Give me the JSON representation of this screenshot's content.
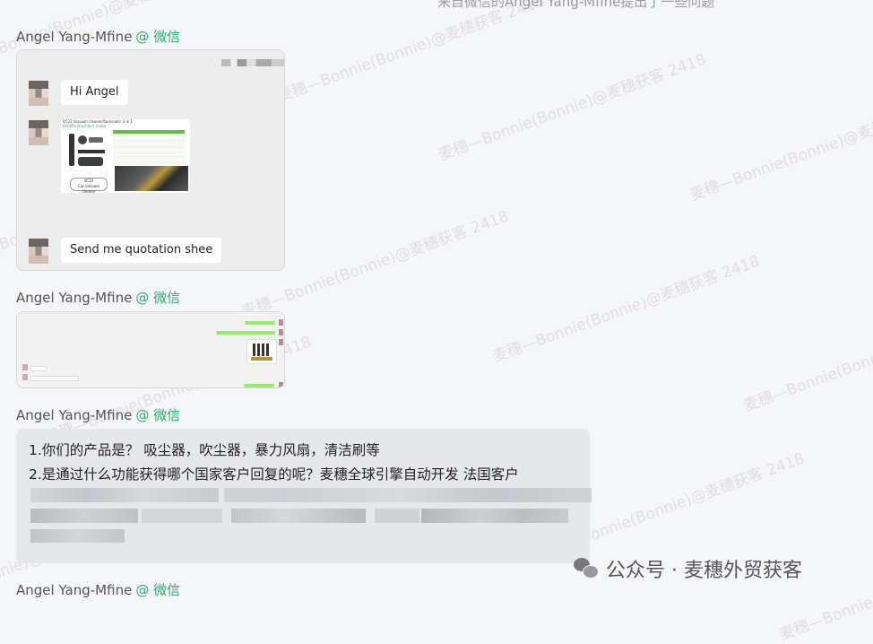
{
  "top_partial_text": "来自微信的Angel Yang-Mfine提出了一些问题",
  "messages": [
    {
      "sender": "Angel Yang-Mfine",
      "app": "@ 微信"
    },
    {
      "sender": "Angel Yang-Mfine",
      "app": "@ 微信"
    },
    {
      "sender": "Angel Yang-Mfine",
      "app": "@ 微信"
    },
    {
      "sender": "Angel Yang-Mfine",
      "app": "@ 微信"
    }
  ],
  "chat_card": {
    "greeting": "Hi Angel",
    "request": "Send me quotation shee",
    "product_image": {
      "title": "VC22 Vacuum cleaner/fan/sealer 3 in 1",
      "subtitle": "6000Pa Brushless motor",
      "caption_line1": "VC22",
      "caption_line2": "Car vacuum cleaner"
    }
  },
  "text_card": {
    "line1": "1.你们的产品是？ 吸尘器，吹尘器，暴力风扇，清洁刷等",
    "line2": "2.是通过什么功能获得哪个国家客户回复的呢？麦穗全球引擎自动开发 法国客户"
  },
  "watermark": "麦穗—Bonnie(Bonnie)@麦穗获客 2418",
  "brand": {
    "name": "公众号 · 麦穗外贸获客",
    "icon": "wechat-icon"
  },
  "colors": {
    "wechat_green": "#2aae67",
    "bubble_green": "#95ec69"
  }
}
